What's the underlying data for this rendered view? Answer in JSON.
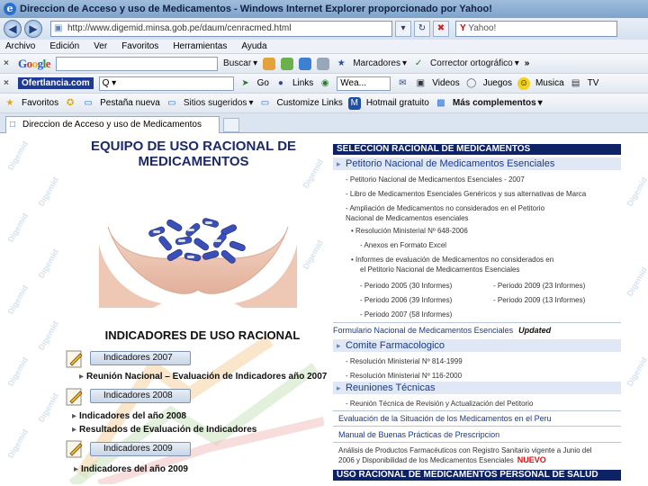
{
  "window": {
    "title": "Direccion de Acceso y uso de Medicamentos - Windows Internet Explorer proporcionado por Yahoo!"
  },
  "address": {
    "url": "http://www.digemid.minsa.gob.pe/daum/cenracmed.html",
    "search_placeholder": "Yahoo!"
  },
  "menu": [
    "Archivo",
    "Edición",
    "Ver",
    "Favoritos",
    "Herramientas",
    "Ayuda"
  ],
  "google_bar": {
    "logo": [
      "G",
      "o",
      "o",
      "g",
      "l",
      "e"
    ],
    "buscar": "Buscar",
    "marcadores": "Marcadores",
    "corrector": "Corrector ortográfico",
    "more": "»"
  },
  "ofertas_bar": {
    "logo": "Ofertlancia.com",
    "search_prefix": "Q",
    "go": "Go",
    "links": "Links",
    "combo": "Wea...",
    "videos": "Videos",
    "juegos": "Juegos",
    "musica": "Musica",
    "tv": "TV"
  },
  "favorites_bar": {
    "favoritos": "Favoritos",
    "pestana_nueva": "Pestaña nueva",
    "sitios": "Sitios sugeridos",
    "customize": "Customize Links",
    "hotmail": "Hotmail gratuito",
    "mas": "Más complementos"
  },
  "tab": {
    "label": "Direccion de Acceso y uso de Medicamentos"
  },
  "page": {
    "title_line1": "EQUIPO DE USO RACIONAL DE",
    "title_line2": "MEDICAMENTOS",
    "indicators_heading": "INDICADORES DE USO RACIONAL",
    "indicator_buttons": [
      "Indicadores 2007",
      "Indicadores 2008",
      "Indicadores 2009"
    ],
    "left_links": [
      "Reunión Nacional – Evaluación de Indicadores año 2007",
      "Indicadores del año 2008",
      "Resultados de Evaluación de Indicadores",
      "Indicadores del año 2009"
    ],
    "watermark": "Digemid",
    "right": {
      "header1": "SELECCION RACIONAL DE MEDICAMENTOS",
      "petitorio": "Petitorio Nacional de Medicamentos Esenciales",
      "items1": [
        "- Petitorio Nacional de Medicamentos Esenciales - 2007",
        "- Libro de Medicamentos Esenciales Genéricos y sus alternativas de Marca",
        "- Ampliación de Medicamentos no considerados en el Petitorio",
        "  Nacional de Medicamentos esenciales"
      ],
      "resolucion": "Resolución Ministerial Nº 648-2006",
      "anexos": "- Anexos en Formato Excel",
      "informes": "Informes de evaluación de Medicamentos no considerados en",
      "informes2": "el Petitorio Nacional de Medicamentos Esenciales",
      "periods": [
        "- Periodo 2005 (30 Informes)",
        "- Periodo 2006 (39 Informes)",
        "- Periodo 2007 (58 Informes)",
        "- Periodo 2009 (23 Informes)",
        "- Periodo 2009 (13 Informes)"
      ],
      "formulario": "Formulario Nacional de Medicamentos Esenciales",
      "updated": "Updated",
      "comite": "Comite Farmacologico",
      "comite_items": [
        "- Resolución Ministerial Nº 814-1999",
        "- Resolución Ministerial Nº 116-2000"
      ],
      "reuniones": "Reuniones Técnicas",
      "reuniones_item": "- Reunión Técnica de Revisión y Actualización del Petitorio",
      "evaluacion": "Evaluación de la Situación de los Medicamentos en el Peru",
      "manual": "Manual de Buenas Prácticas de Prescripcion",
      "analisis1": "Análisis de Productos Farmacéuticos con Registro Sanitario vigente a Junio del",
      "analisis2": "2006 y Disponibilidad de los Medicamentos Esenciales",
      "nuevo": "NUEVO",
      "header2": "USO RACIONAL DE MEDICAMENTOS PERSONAL DE SALUD"
    }
  }
}
